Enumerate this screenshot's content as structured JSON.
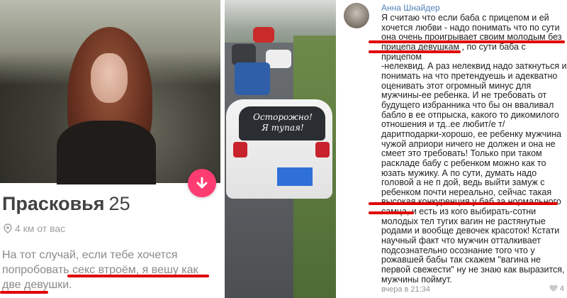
{
  "profile": {
    "name": "Прасковья",
    "age": "25",
    "distance": "4 км от вас",
    "bio": "На тот случай, если тебе хочется попробовать секс втроём, я вешу как две девушки.",
    "like_icon": "arrow-down-icon",
    "location_icon": "location-pin-icon",
    "like_color": "#fe3c72"
  },
  "car_photo": {
    "sticker_text": "Осторожно!\nЯ тупая!"
  },
  "comment": {
    "author": "Анна Шнайдер",
    "text": "Я считаю что если баба с прицепом и ей\nхочется любви - надо понимать что по сути\nона очень проигрывает своим молодым без\nприцепа девушкам , по сути баба с прицепом\n-нелеквид. А раз нелеквид надо заткнуться и\nпонимать на что претендуешь и адекватно\nоценивать этот огромный минус для\nмужчины-ее ребенка. И не требовать от\nбудущего избранника что бы он вваливал\nбабло в ее отпрыска, какого то дикомилого\nотношения и тд..ее любит/е     т/\nдаритподарки-хорошо, ее ребенку мужчина\nчужой априори ничего не должен и она не\nсмеет это требовать! Только при таком\nраскладе бабу с ребенком можно как то\nюзать мужику. А по сути, думать надо\nголовой а не п  дой, ведь выйти замуж с\nребенком почти нереально, сейчас такая\nвысокая конкуренция у баб за нормального\nсамца, и есть из кого выбирать-сотни\nмолодых тел тугих вагин не растянутые\nродами и вообще девочек красоток! Кстати\nнаучный факт что мужчин отталкивает\nподсознательно осознание того что у\nрожавшей бабы так скажем \"вагина не\nпервой свежести\" ну не знаю как выразится,\nмужчины поймут.",
    "timestamp": "вчера в 21:34",
    "likes": "4",
    "author_color": "#5181b8",
    "highlight_color": "#e00000"
  }
}
